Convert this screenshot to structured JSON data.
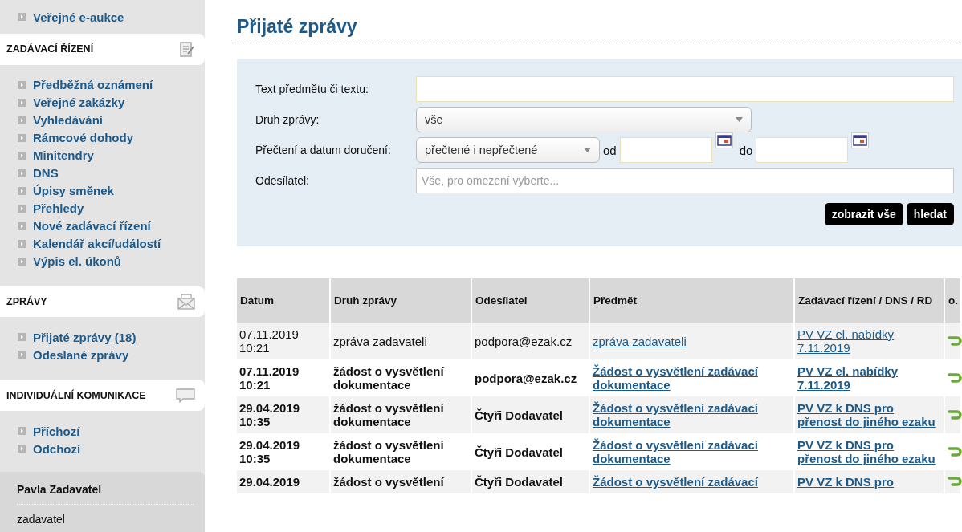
{
  "sidebar": {
    "top_items": [
      {
        "label": "Veřejné e-aukce",
        "selected": false
      }
    ],
    "sections": [
      {
        "title": "ZADÁVACÍ ŘÍZENÍ",
        "items": [
          {
            "label": "Předběžná oznámení",
            "selected": false
          },
          {
            "label": "Veřejné zakázky",
            "selected": false
          },
          {
            "label": "Vyhledávání",
            "selected": false
          },
          {
            "label": "Rámcové dohody",
            "selected": false
          },
          {
            "label": "Minitendry",
            "selected": false
          },
          {
            "label": "DNS",
            "selected": false
          },
          {
            "label": "Úpisy směnek",
            "selected": false
          },
          {
            "label": "Přehledy",
            "selected": false
          },
          {
            "label": "Nové zadávací řízení",
            "selected": false
          },
          {
            "label": "Kalendář akcí/událostí",
            "selected": false
          },
          {
            "label": "Výpis el. úkonů",
            "selected": false
          }
        ]
      },
      {
        "title": "ZPRÁVY",
        "items": [
          {
            "label": "Přijaté zprávy (18)",
            "selected": true
          },
          {
            "label": "Odeslané zprávy",
            "selected": false
          }
        ]
      },
      {
        "title": "INDIVIDUÁLNÍ KOMUNIKACE",
        "items": [
          {
            "label": "Příchozí",
            "selected": false
          },
          {
            "label": "Odchozí",
            "selected": false
          }
        ]
      }
    ],
    "user": {
      "name": "Pavla Zadavatel",
      "role": "zadavatel"
    }
  },
  "page_title": "Přijaté zprávy",
  "filter": {
    "fields": [
      {
        "kind": "text",
        "label": "Text předmětu či textu:"
      },
      {
        "kind": "select",
        "label": "Druh zprávy:",
        "value": "vše"
      },
      {
        "kind": "daterange",
        "label": "Přečtení a datum doručení:",
        "value": "přečtené i nepřečtené",
        "from_label": "od",
        "to_label": "do"
      },
      {
        "kind": "text",
        "label": "Odesílatel:",
        "placeholder": "Vše, pro omezení vyberte..."
      }
    ],
    "buttons": [
      "zobrazit vše",
      "hledat"
    ]
  },
  "table": {
    "columns": [
      "Datum",
      "Druh zprávy",
      "Odesílatel",
      "Předmět",
      "Zadávací řízení / DNS / RD",
      "o."
    ],
    "rows": [
      {
        "read": true,
        "date": "07.11.2019 10:21",
        "type": "zpráva zadavateli",
        "sender": "podpora@ezak.cz",
        "subject": "zpráva zadavateli",
        "proceeding": "PV VZ el. nabídky 7.11.2019"
      },
      {
        "read": false,
        "date": "07.11.2019 10:21",
        "type": "žádost o vysvětlení dokumentace",
        "sender": "podpora@ezak.cz",
        "subject": "Žádost o vysvětlení zadávací dokumentace",
        "proceeding": "PV VZ el. nabídky 7.11.2019"
      },
      {
        "read": false,
        "date": "29.04.2019 10:35",
        "type": "žádost o vysvětlení dokumentace",
        "sender": "Čtyři Dodavatel",
        "subject": "Žádost o vysvětlení zadávací dokumentace",
        "proceeding": "PV VZ k DNS pro přenost do jiného ezaku"
      },
      {
        "read": false,
        "date": "29.04.2019 10:35",
        "type": "žádost o vysvětlení dokumentace",
        "sender": "Čtyři Dodavatel",
        "subject": "Žádost o vysvětlení zadávací dokumentace",
        "proceeding": "PV VZ k DNS pro přenost do jiného ezaku"
      },
      {
        "read": false,
        "date": "29.04.2019",
        "type": "žádost o vysvětlení",
        "sender": "Čtyři Dodavatel",
        "subject": "Žádost o vysvětlení zadávací",
        "proceeding": "PV VZ k DNS pro"
      }
    ]
  }
}
